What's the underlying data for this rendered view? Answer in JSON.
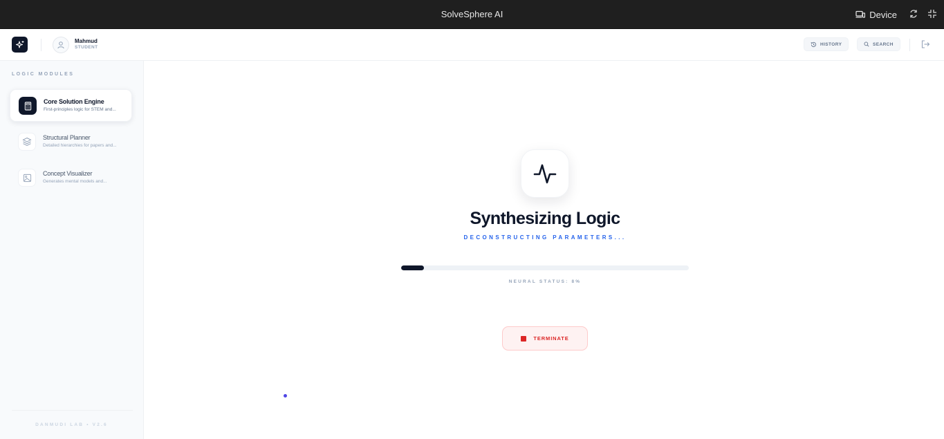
{
  "window": {
    "title": "SolveSphere AI",
    "device_label": "Device"
  },
  "header": {
    "user_name": "Mahmud",
    "user_role": "STUDENT",
    "history_label": "HISTORY",
    "search_label": "SEARCH"
  },
  "sidebar": {
    "section_title": "LOGIC MODULES",
    "modules": [
      {
        "title": "Core Solution Engine",
        "description": "First-principles logic for STEM and...",
        "active": true,
        "icon": "calculator-icon"
      },
      {
        "title": "Structural Planner",
        "description": "Detailed hierarchies for papers and...",
        "active": false,
        "icon": "layers-icon"
      },
      {
        "title": "Concept Visualizer",
        "description": "Generates mental models and...",
        "active": false,
        "icon": "image-icon"
      }
    ],
    "footer": "DANMUDI LAB • V2.6"
  },
  "main": {
    "status_title": "Synthesizing Logic",
    "status_subtitle": "DECONSTRUCTING PARAMETERS...",
    "progress_percent": 8,
    "neural_status": "NEURAL STATUS: 8%",
    "terminate_label": "TERMINATE"
  },
  "colors": {
    "titlebar_bg": "#1f1f1f",
    "brand_dark": "#0f172a",
    "accent_blue": "#2563eb",
    "danger": "#dc2626",
    "sidebar_bg": "#f8fafc",
    "muted": "#94a3b8"
  }
}
